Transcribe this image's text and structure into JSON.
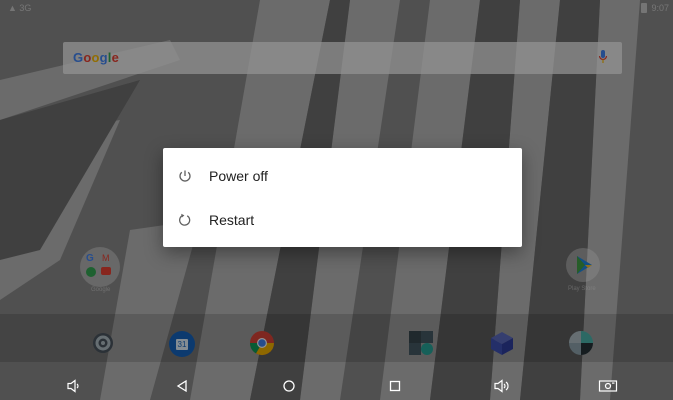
{
  "status_bar": {
    "left_indicator": "▲ 3G",
    "time": "9:07"
  },
  "search": {
    "logo_text": "Google",
    "logo_colors": [
      "#4285F4",
      "#EA4335",
      "#FBBC05",
      "#4285F4",
      "#34A853",
      "#EA4335"
    ]
  },
  "home_apps": [
    {
      "name": "Google"
    },
    {
      "name": "Play Store"
    }
  ],
  "dock_icons": [
    "settings-icon",
    "calendar-icon",
    "chrome-icon",
    "calculator-icon",
    "box-app-icon",
    "photos-icon"
  ],
  "calendar_day": "31",
  "power_menu": {
    "items": [
      {
        "label": "Power off",
        "icon": "power-icon"
      },
      {
        "label": "Restart",
        "icon": "restart-icon"
      }
    ]
  },
  "nav_bar": [
    "volume-down-icon",
    "back-icon",
    "home-icon",
    "recents-icon",
    "volume-up-icon",
    "screenshot-icon"
  ],
  "colors": {
    "dialog_bg": "#ffffff",
    "text": "#212121",
    "icon": "#616161",
    "scrim": "rgba(0,0,0,0.42)"
  }
}
